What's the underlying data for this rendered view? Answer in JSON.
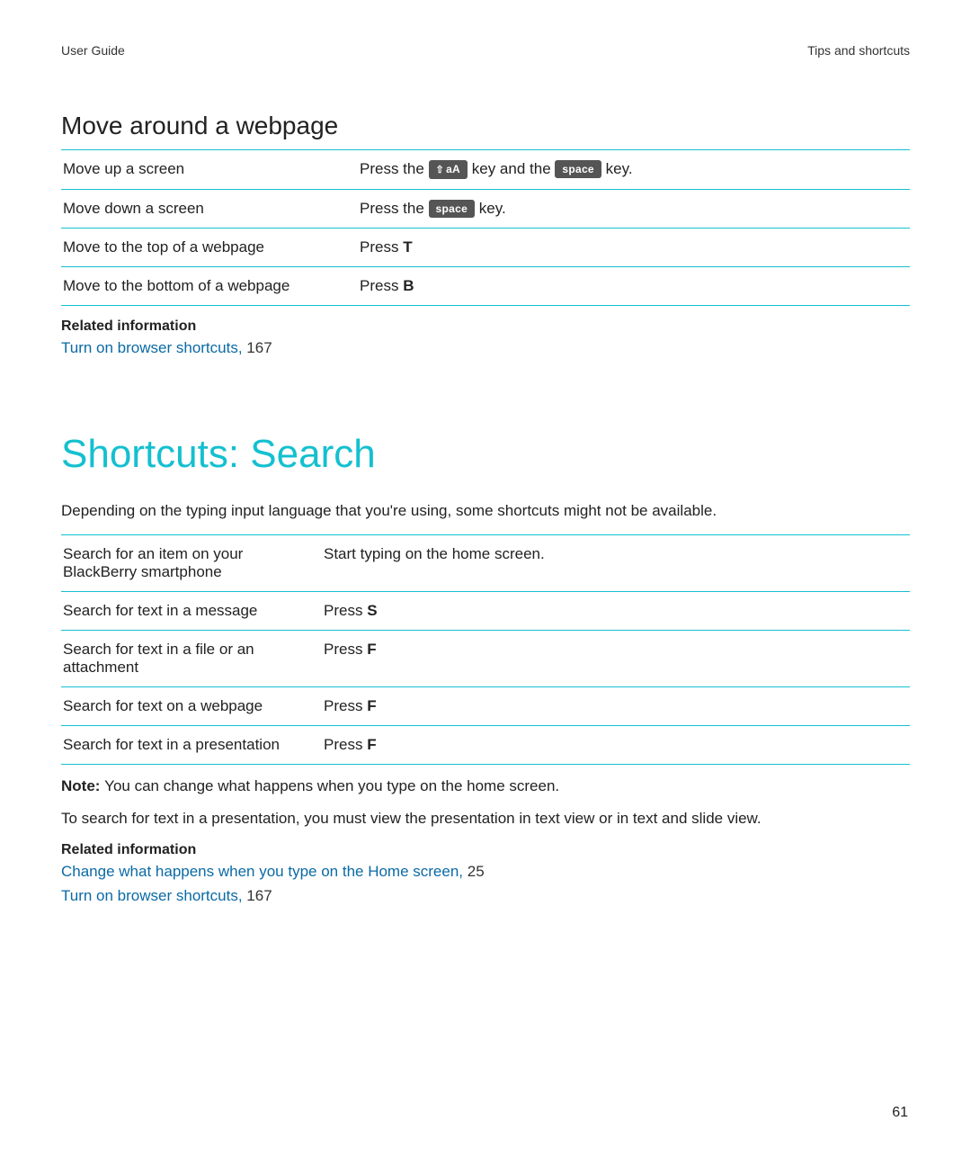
{
  "header": {
    "left": "User Guide",
    "right": "Tips and shortcuts"
  },
  "section1": {
    "title": "Move around a webpage",
    "rows": [
      {
        "action": "Move up a screen",
        "instr_parts": {
          "pre": "Press the ",
          "key1_sym": "⇧",
          "key1_txt": "aA",
          "mid": " key and the ",
          "key2": "space",
          "post": " key."
        }
      },
      {
        "action": "Move down a screen",
        "instr_parts": {
          "pre": "Press the ",
          "key": "space",
          "post": " key."
        }
      },
      {
        "action": "Move to the top of a webpage",
        "instr_parts": {
          "pre": "Press ",
          "letter": "T"
        }
      },
      {
        "action": "Move to the bottom of a webpage",
        "instr_parts": {
          "pre": "Press ",
          "letter": "B"
        }
      }
    ],
    "related_label": "Related information",
    "related_links": [
      {
        "text": "Turn on browser shortcuts,",
        "page": " 167"
      }
    ]
  },
  "section2": {
    "title": "Shortcuts: Search",
    "intro": "Depending on the typing input language that you're using, some shortcuts might not be available.",
    "rows": [
      {
        "action": "Search for an item on your BlackBerry smartphone",
        "type": "plain",
        "instr": "Start typing on the home screen."
      },
      {
        "action": "Search for text in a message",
        "type": "letter",
        "pre": "Press ",
        "letter": "S"
      },
      {
        "action": "Search for text in a file or an attachment",
        "type": "letter",
        "pre": "Press ",
        "letter": "F"
      },
      {
        "action": "Search for text on a webpage",
        "type": "letter",
        "pre": "Press ",
        "letter": "F"
      },
      {
        "action": "Search for text in a presentation",
        "type": "letter",
        "pre": "Press ",
        "letter": "F"
      }
    ],
    "note_label": "Note: ",
    "note_text": "You can change what happens when you type on the home screen.",
    "extra": "To search for text in a presentation, you must view the presentation in text view or in text and slide view.",
    "related_label": "Related information",
    "related_links": [
      {
        "text": "Change what happens when you type on the Home screen,",
        "page": " 25"
      },
      {
        "text": "Turn on browser shortcuts,",
        "page": " 167"
      }
    ]
  },
  "page_number": "61"
}
